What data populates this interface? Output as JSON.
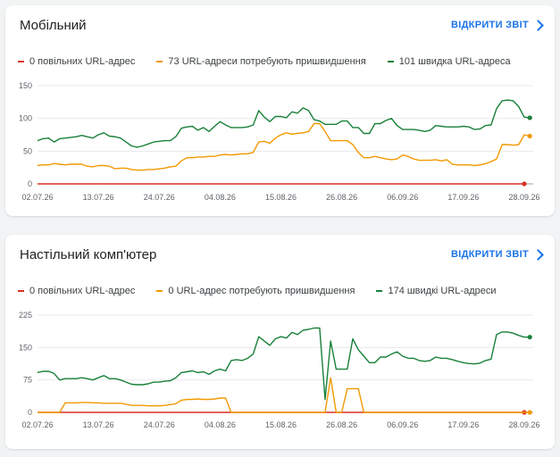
{
  "cards": [
    {
      "title": "Мобільний",
      "open_report": "ВІДКРИТИ ЗВІТ",
      "legend": [
        {
          "label": "0 повільних URL-адрес",
          "color": "#d93025"
        },
        {
          "label": "73 URL-адреси потребують пришвидшення",
          "color": "#f29900"
        },
        {
          "label": "101 швидка URL-адреса",
          "color": "#188038"
        }
      ]
    },
    {
      "title": "Настільний комп'ютер",
      "open_report": "ВІДКРИТИ ЗВІТ",
      "legend": [
        {
          "label": "0 повільних URL-адрес",
          "color": "#d93025"
        },
        {
          "label": "0 URL-адрес потребують пришвидшення",
          "color": "#f29900"
        },
        {
          "label": "174 швидкі URL-адреси",
          "color": "#188038"
        }
      ]
    }
  ],
  "chart_data": [
    {
      "type": "line",
      "ylim": [
        0,
        150
      ],
      "yticks": [
        0,
        50,
        100,
        150
      ],
      "xticks": [
        {
          "i": 0,
          "label": "02.07.26"
        },
        {
          "i": 11,
          "label": "13.07.26"
        },
        {
          "i": 22,
          "label": "24.07.26"
        },
        {
          "i": 33,
          "label": "04.08.26"
        },
        {
          "i": 44,
          "label": "15.08.26"
        },
        {
          "i": 55,
          "label": "26.08.26"
        },
        {
          "i": 66,
          "label": "06.09.26"
        },
        {
          "i": 77,
          "label": "17.09.26"
        },
        {
          "i": 88,
          "label": "28.09.26"
        }
      ],
      "series": [
        {
          "name": "0 повільних URL-адрес",
          "color": "#d93025",
          "values": [
            0,
            0,
            0,
            0,
            0,
            0,
            0,
            0,
            0,
            0,
            0,
            0,
            0,
            0,
            0,
            0,
            0,
            0,
            0,
            0,
            0,
            0,
            0,
            0,
            0,
            0,
            0,
            0,
            0,
            0,
            0,
            0,
            0,
            0,
            0,
            0,
            0,
            0,
            0,
            0,
            0,
            0,
            0,
            0,
            0,
            0,
            0,
            0,
            0,
            0,
            0,
            0,
            0,
            0,
            0,
            0,
            0,
            0,
            0,
            0,
            0,
            0,
            0,
            0,
            0,
            0,
            0,
            0,
            0,
            0,
            0,
            0,
            0,
            0,
            0,
            0,
            0,
            0,
            0,
            0,
            0,
            0,
            0,
            0,
            0,
            0,
            0,
            0,
            0
          ]
        },
        {
          "name": "73 URL-адреси потребують пришвидшення",
          "color": "#f29900",
          "values": [
            28,
            29,
            29,
            31,
            30,
            29,
            30,
            30,
            30,
            27,
            26,
            28,
            28,
            27,
            23,
            24,
            24,
            22,
            21,
            21,
            22,
            22,
            23,
            24,
            26,
            27,
            35,
            40,
            40,
            41,
            41,
            42,
            42,
            44,
            45,
            44,
            45,
            46,
            46,
            48,
            64,
            65,
            62,
            70,
            75,
            78,
            76,
            77,
            78,
            80,
            92,
            92,
            80,
            66,
            66,
            66,
            66,
            60,
            48,
            40,
            40,
            42,
            40,
            38,
            37,
            38,
            44,
            42,
            38,
            36,
            36,
            36,
            37,
            35,
            37,
            30,
            29,
            29,
            29,
            28,
            29,
            31,
            34,
            38,
            60,
            60,
            59,
            60,
            75,
            73
          ]
        },
        {
          "name": "101 швидка URL-адреса",
          "color": "#188038",
          "values": [
            66,
            69,
            70,
            64,
            69,
            70,
            71,
            72,
            74,
            72,
            70,
            75,
            78,
            73,
            72,
            70,
            64,
            58,
            56,
            58,
            61,
            64,
            65,
            66,
            66,
            72,
            85,
            87,
            88,
            82,
            86,
            80,
            88,
            95,
            90,
            86,
            86,
            86,
            87,
            90,
            112,
            102,
            95,
            103,
            103,
            101,
            110,
            108,
            116,
            112,
            98,
            96,
            91,
            91,
            91,
            96,
            96,
            86,
            86,
            77,
            77,
            92,
            92,
            97,
            100,
            89,
            83,
            83,
            83,
            82,
            80,
            82,
            89,
            88,
            87,
            87,
            87,
            88,
            87,
            83,
            84,
            89,
            90,
            115,
            127,
            128,
            127,
            118,
            102,
            101
          ]
        }
      ]
    },
    {
      "type": "line",
      "ylim": [
        0,
        225
      ],
      "yticks": [
        0,
        75,
        150,
        225
      ],
      "xticks": [
        {
          "i": 0,
          "label": "02.07.26"
        },
        {
          "i": 11,
          "label": "13.07.26"
        },
        {
          "i": 22,
          "label": "24.07.26"
        },
        {
          "i": 33,
          "label": "04.08.26"
        },
        {
          "i": 44,
          "label": "15.08.26"
        },
        {
          "i": 55,
          "label": "26.08.26"
        },
        {
          "i": 66,
          "label": "06.09.26"
        },
        {
          "i": 77,
          "label": "17.09.26"
        },
        {
          "i": 88,
          "label": "28.09.26"
        }
      ],
      "series": [
        {
          "name": "0 повільних URL-адрес",
          "color": "#d93025",
          "values": [
            0,
            0,
            0,
            0,
            0,
            0,
            0,
            0,
            0,
            0,
            0,
            0,
            0,
            0,
            0,
            0,
            0,
            0,
            0,
            0,
            0,
            0,
            0,
            0,
            0,
            0,
            0,
            0,
            0,
            0,
            0,
            0,
            0,
            0,
            0,
            0,
            0,
            0,
            0,
            0,
            0,
            0,
            0,
            0,
            0,
            0,
            0,
            0,
            0,
            0,
            0,
            0,
            0,
            0,
            0,
            0,
            0,
            0,
            0,
            0,
            0,
            0,
            0,
            0,
            0,
            0,
            0,
            0,
            0,
            0,
            0,
            0,
            0,
            0,
            0,
            0,
            0,
            0,
            0,
            0,
            0,
            0,
            0,
            0,
            0,
            0,
            0,
            0,
            0
          ]
        },
        {
          "name": "0 URL-адрес потребують пришвидшення",
          "color": "#f29900",
          "values": [
            0,
            0,
            0,
            0,
            0,
            22,
            22,
            22,
            23,
            23,
            22,
            22,
            21,
            21,
            21,
            21,
            19,
            16,
            16,
            16,
            15,
            15,
            15,
            16,
            18,
            20,
            28,
            30,
            30,
            31,
            30,
            30,
            31,
            33,
            33,
            0,
            0,
            0,
            0,
            0,
            0,
            0,
            0,
            0,
            0,
            0,
            0,
            0,
            0,
            0,
            0,
            0,
            0,
            80,
            0,
            0,
            55,
            55,
            55,
            0,
            0,
            0,
            0,
            0,
            0,
            0,
            0,
            0,
            0,
            0,
            0,
            0,
            0,
            0,
            0,
            0,
            0,
            0,
            0,
            0,
            0,
            0,
            0,
            0,
            0,
            0,
            0,
            0,
            0,
            0
          ]
        },
        {
          "name": "174 швидкі URL-адреси",
          "color": "#188038",
          "values": [
            92,
            95,
            95,
            90,
            75,
            78,
            78,
            78,
            80,
            78,
            75,
            80,
            85,
            78,
            78,
            75,
            70,
            65,
            64,
            64,
            66,
            70,
            70,
            72,
            73,
            80,
            92,
            94,
            96,
            92,
            94,
            88,
            96,
            100,
            96,
            120,
            122,
            120,
            125,
            135,
            175,
            165,
            155,
            170,
            175,
            172,
            185,
            180,
            190,
            192,
            195,
            195,
            30,
            165,
            100,
            100,
            100,
            170,
            145,
            130,
            115,
            115,
            128,
            128,
            135,
            140,
            130,
            125,
            125,
            120,
            118,
            120,
            128,
            125,
            125,
            122,
            118,
            115,
            113,
            112,
            114,
            120,
            123,
            180,
            186,
            186,
            183,
            178,
            174,
            174
          ]
        }
      ]
    }
  ]
}
